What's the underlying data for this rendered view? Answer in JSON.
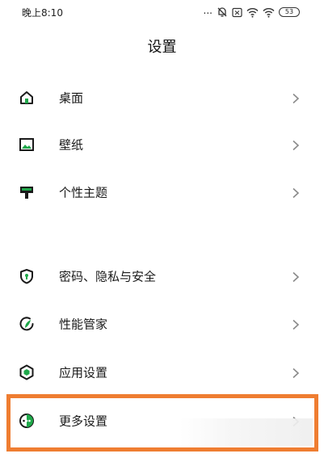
{
  "status_bar": {
    "time": "晚上8:10",
    "dots": "...",
    "battery": "53"
  },
  "page": {
    "title": "设置"
  },
  "groups": [
    {
      "items": [
        {
          "label": "桌面",
          "icon": "home-icon"
        },
        {
          "label": "壁纸",
          "icon": "wallpaper-icon"
        },
        {
          "label": "个性主题",
          "icon": "theme-icon"
        }
      ]
    },
    {
      "items": [
        {
          "label": "密码、隐私与安全",
          "icon": "shield-icon"
        },
        {
          "label": "性能管家",
          "icon": "performance-icon"
        },
        {
          "label": "应用设置",
          "icon": "app-settings-icon"
        },
        {
          "label": "更多设置",
          "icon": "more-settings-icon"
        }
      ]
    }
  ],
  "colors": {
    "accent": "#1fa84a",
    "highlight": "#ef7d31",
    "text": "#1a1a1a",
    "chevron": "#9a9a9a"
  }
}
